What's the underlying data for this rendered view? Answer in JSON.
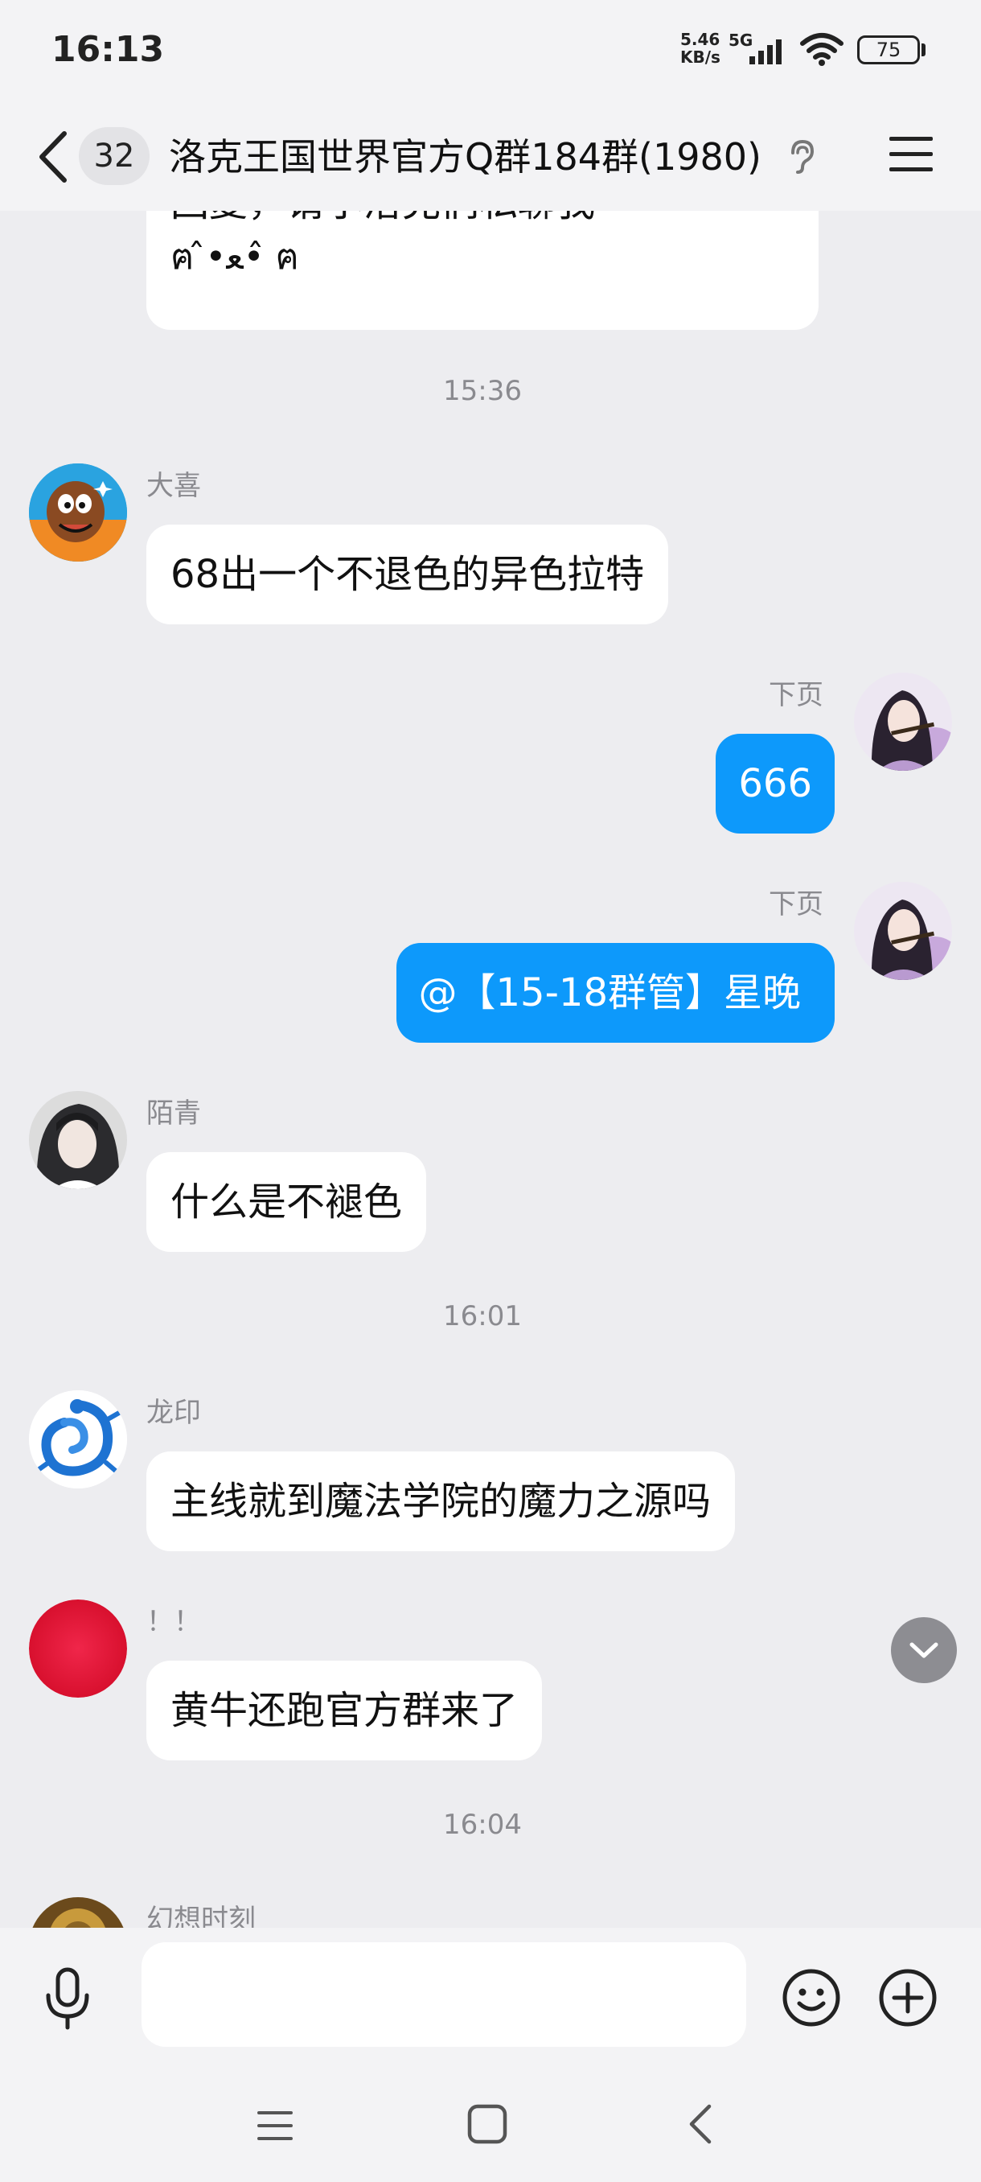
{
  "status_bar": {
    "time": "16:13",
    "net_speed_value": "5.46",
    "net_speed_unit": "KB/s",
    "network": "5G",
    "battery": "75"
  },
  "header": {
    "unread_count": "32",
    "title": "洛克王国世界官方Q群184群(1980)"
  },
  "messages": [
    {
      "type": "incoming",
      "text_line1": "回复，请小洛克们私聊我",
      "text_line2": "ฅ ̂•ﻌ• ̂ฅ"
    },
    {
      "type": "timestamp",
      "text": "15:36"
    },
    {
      "type": "incoming",
      "sender": "大喜",
      "text": "68出一个不退色的异色拉特"
    },
    {
      "type": "outgoing",
      "sender": "下页",
      "text": "666"
    },
    {
      "type": "outgoing",
      "sender": "下页",
      "text": "@【15-18群管】星晚"
    },
    {
      "type": "incoming",
      "sender": "陌青",
      "text": "什么是不褪色"
    },
    {
      "type": "timestamp",
      "text": "16:01"
    },
    {
      "type": "incoming",
      "sender": "龙印",
      "text": "主线就到魔法学院的魔力之源吗"
    },
    {
      "type": "incoming",
      "sender": "！！",
      "text": "黄牛还跑官方群来了"
    },
    {
      "type": "timestamp",
      "text": "16:04"
    },
    {
      "type": "incoming",
      "sender": "幻想时刻"
    }
  ],
  "input": {
    "placeholder": ""
  },
  "colors": {
    "outgoing_bubble": "#0d99fb",
    "incoming_bubble": "#ffffff",
    "chat_background": "#ededf0"
  }
}
